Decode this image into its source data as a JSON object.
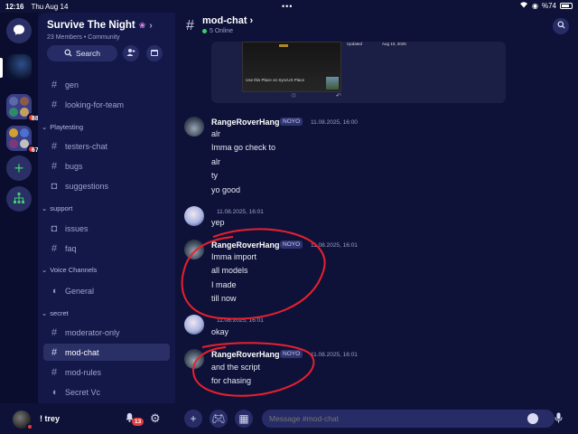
{
  "status_bar": {
    "time": "12:16",
    "date": "Thu Aug 14",
    "battery": "%74",
    "dots": "•••"
  },
  "server_rail": {
    "folder1_badge": "88",
    "folder2_badge": "67"
  },
  "guild": {
    "name": "Survive The Night",
    "members": "23 Members",
    "community": "Community",
    "search_label": "Search"
  },
  "channels": {
    "top": [
      {
        "name": "gen"
      },
      {
        "name": "looking-for-team"
      }
    ],
    "categories": [
      {
        "name": "Playtesting",
        "items": [
          "testers-chat",
          "bugs",
          "suggestions"
        ]
      },
      {
        "name": "support",
        "items": [
          "issues",
          "faq"
        ]
      },
      {
        "name": "Voice Channels",
        "items": [
          "General"
        ]
      },
      {
        "name": "secret",
        "items": [
          "moderator-only",
          "mod-chat",
          "mod-rules",
          "Secret Vc"
        ]
      }
    ]
  },
  "user": {
    "name": "! trey",
    "notif_badge": "13"
  },
  "chat": {
    "channel": "mod-chat",
    "online": "5 Online",
    "embed": {
      "caption": "Use this Place on SyncUS Place",
      "updated_label": "Updated",
      "updated_value": "Aug 10, 2025"
    },
    "messages": [
      {
        "author": "RangeRoverHang",
        "tag": "NOYO",
        "time": "11.08.2025, 16:00",
        "lines": [
          "alr",
          "Imma go check to",
          "alr",
          "ty",
          "yo good"
        ]
      },
      {
        "author": "",
        "tag": "",
        "time": "11.08.2025, 16:01",
        "lines": [
          "yep"
        ]
      },
      {
        "author": "RangeRoverHang",
        "tag": "NOYO",
        "time": "11.08.2025, 16:01",
        "lines": [
          "Imma import",
          "all models",
          "I made",
          "till now"
        ]
      },
      {
        "author": "",
        "tag": "",
        "time": "11.08.2025, 16:01",
        "lines": [
          "okay"
        ]
      },
      {
        "author": "RangeRoverHang",
        "tag": "NOYO",
        "time": "11.08.2025, 16:01",
        "lines": [
          "and the script",
          "for chasing"
        ]
      }
    ],
    "composer_placeholder": "Message #mod-chat"
  },
  "colors": {
    "accent_online": "#3ccf6e",
    "badge_red": "#e23c3c",
    "annotation_red": "#e8202e"
  }
}
